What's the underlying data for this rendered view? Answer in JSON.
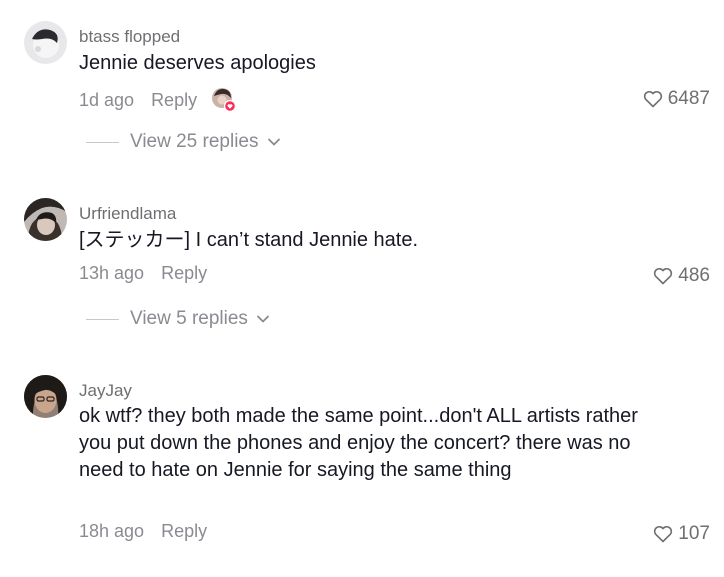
{
  "comments": [
    {
      "username": "btass flopped",
      "text": "Jennie deserves apologies",
      "time": "1d ago",
      "reply_label": "Reply",
      "likes": "6487",
      "view_replies": "View 25 replies",
      "creator_liked": true
    },
    {
      "username": "Urfriendlama",
      "text": "[ステッカー] I can’t stand Jennie hate.",
      "time": "13h ago",
      "reply_label": "Reply",
      "likes": "486",
      "view_replies": "View 5 replies"
    },
    {
      "username": "JayJay",
      "text": "ok wtf? they both made the same point...don't ALL artists rather you put down the phones and enjoy the concert? there was no need to hate on Jennie for saying the same thing",
      "time": "18h ago",
      "reply_label": "Reply",
      "likes": "107"
    }
  ],
  "icons": {
    "like": "heart-outline-icon",
    "expand": "chevron-down-icon"
  },
  "colors": {
    "text": "#161823",
    "secondary": "#8a8b91",
    "creator_badge": "#fe2c55"
  }
}
